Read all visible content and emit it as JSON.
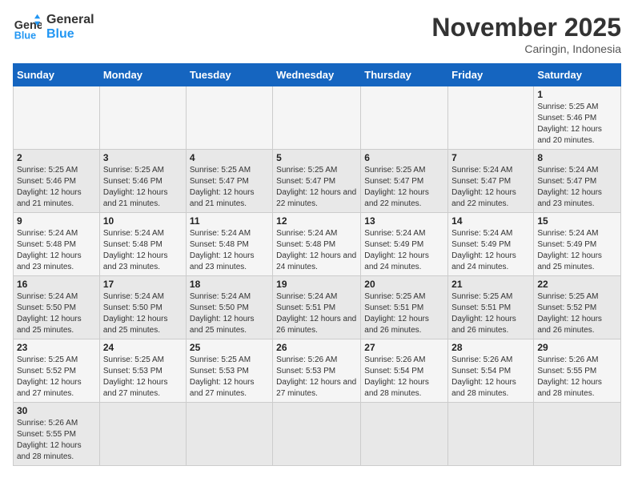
{
  "logo": {
    "line1": "General",
    "line2": "Blue"
  },
  "title": "November 2025",
  "subtitle": "Caringin, Indonesia",
  "days_of_week": [
    "Sunday",
    "Monday",
    "Tuesday",
    "Wednesday",
    "Thursday",
    "Friday",
    "Saturday"
  ],
  "weeks": [
    [
      {
        "day": "",
        "info": ""
      },
      {
        "day": "",
        "info": ""
      },
      {
        "day": "",
        "info": ""
      },
      {
        "day": "",
        "info": ""
      },
      {
        "day": "",
        "info": ""
      },
      {
        "day": "",
        "info": ""
      },
      {
        "day": "1",
        "info": "Sunrise: 5:25 AM\nSunset: 5:46 PM\nDaylight: 12 hours and 20 minutes."
      }
    ],
    [
      {
        "day": "2",
        "info": "Sunrise: 5:25 AM\nSunset: 5:46 PM\nDaylight: 12 hours and 21 minutes."
      },
      {
        "day": "3",
        "info": "Sunrise: 5:25 AM\nSunset: 5:46 PM\nDaylight: 12 hours and 21 minutes."
      },
      {
        "day": "4",
        "info": "Sunrise: 5:25 AM\nSunset: 5:47 PM\nDaylight: 12 hours and 21 minutes."
      },
      {
        "day": "5",
        "info": "Sunrise: 5:25 AM\nSunset: 5:47 PM\nDaylight: 12 hours and 22 minutes."
      },
      {
        "day": "6",
        "info": "Sunrise: 5:25 AM\nSunset: 5:47 PM\nDaylight: 12 hours and 22 minutes."
      },
      {
        "day": "7",
        "info": "Sunrise: 5:24 AM\nSunset: 5:47 PM\nDaylight: 12 hours and 22 minutes."
      },
      {
        "day": "8",
        "info": "Sunrise: 5:24 AM\nSunset: 5:47 PM\nDaylight: 12 hours and 23 minutes."
      }
    ],
    [
      {
        "day": "9",
        "info": "Sunrise: 5:24 AM\nSunset: 5:48 PM\nDaylight: 12 hours and 23 minutes."
      },
      {
        "day": "10",
        "info": "Sunrise: 5:24 AM\nSunset: 5:48 PM\nDaylight: 12 hours and 23 minutes."
      },
      {
        "day": "11",
        "info": "Sunrise: 5:24 AM\nSunset: 5:48 PM\nDaylight: 12 hours and 23 minutes."
      },
      {
        "day": "12",
        "info": "Sunrise: 5:24 AM\nSunset: 5:48 PM\nDaylight: 12 hours and 24 minutes."
      },
      {
        "day": "13",
        "info": "Sunrise: 5:24 AM\nSunset: 5:49 PM\nDaylight: 12 hours and 24 minutes."
      },
      {
        "day": "14",
        "info": "Sunrise: 5:24 AM\nSunset: 5:49 PM\nDaylight: 12 hours and 24 minutes."
      },
      {
        "day": "15",
        "info": "Sunrise: 5:24 AM\nSunset: 5:49 PM\nDaylight: 12 hours and 25 minutes."
      }
    ],
    [
      {
        "day": "16",
        "info": "Sunrise: 5:24 AM\nSunset: 5:50 PM\nDaylight: 12 hours and 25 minutes."
      },
      {
        "day": "17",
        "info": "Sunrise: 5:24 AM\nSunset: 5:50 PM\nDaylight: 12 hours and 25 minutes."
      },
      {
        "day": "18",
        "info": "Sunrise: 5:24 AM\nSunset: 5:50 PM\nDaylight: 12 hours and 25 minutes."
      },
      {
        "day": "19",
        "info": "Sunrise: 5:24 AM\nSunset: 5:51 PM\nDaylight: 12 hours and 26 minutes."
      },
      {
        "day": "20",
        "info": "Sunrise: 5:25 AM\nSunset: 5:51 PM\nDaylight: 12 hours and 26 minutes."
      },
      {
        "day": "21",
        "info": "Sunrise: 5:25 AM\nSunset: 5:51 PM\nDaylight: 12 hours and 26 minutes."
      },
      {
        "day": "22",
        "info": "Sunrise: 5:25 AM\nSunset: 5:52 PM\nDaylight: 12 hours and 26 minutes."
      }
    ],
    [
      {
        "day": "23",
        "info": "Sunrise: 5:25 AM\nSunset: 5:52 PM\nDaylight: 12 hours and 27 minutes."
      },
      {
        "day": "24",
        "info": "Sunrise: 5:25 AM\nSunset: 5:53 PM\nDaylight: 12 hours and 27 minutes."
      },
      {
        "day": "25",
        "info": "Sunrise: 5:25 AM\nSunset: 5:53 PM\nDaylight: 12 hours and 27 minutes."
      },
      {
        "day": "26",
        "info": "Sunrise: 5:26 AM\nSunset: 5:53 PM\nDaylight: 12 hours and 27 minutes."
      },
      {
        "day": "27",
        "info": "Sunrise: 5:26 AM\nSunset: 5:54 PM\nDaylight: 12 hours and 28 minutes."
      },
      {
        "day": "28",
        "info": "Sunrise: 5:26 AM\nSunset: 5:54 PM\nDaylight: 12 hours and 28 minutes."
      },
      {
        "day": "29",
        "info": "Sunrise: 5:26 AM\nSunset: 5:55 PM\nDaylight: 12 hours and 28 minutes."
      }
    ],
    [
      {
        "day": "30",
        "info": "Sunrise: 5:26 AM\nSunset: 5:55 PM\nDaylight: 12 hours and 28 minutes."
      },
      {
        "day": "",
        "info": ""
      },
      {
        "day": "",
        "info": ""
      },
      {
        "day": "",
        "info": ""
      },
      {
        "day": "",
        "info": ""
      },
      {
        "day": "",
        "info": ""
      },
      {
        "day": "",
        "info": ""
      }
    ]
  ]
}
